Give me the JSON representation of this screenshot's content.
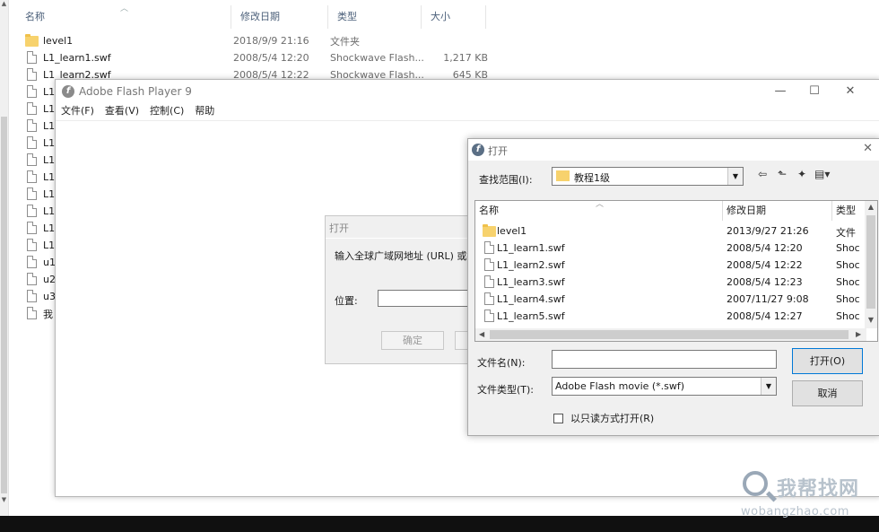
{
  "explorer": {
    "columns": [
      "名称",
      "修改日期",
      "类型",
      "大小"
    ],
    "rows": [
      {
        "name": "level1",
        "date": "2018/9/9 21:16",
        "type": "文件夹",
        "size": "",
        "icon": "folder-icon"
      },
      {
        "name": "L1_learn1.swf",
        "date": "2008/5/4 12:20",
        "type": "Shockwave Flash...",
        "size": "1,217 KB",
        "icon": "file-icon"
      },
      {
        "name": "L1_learn2.swf",
        "date": "2008/5/4 12:22",
        "type": "Shockwave Flash...",
        "size": "645 KB",
        "icon": "file-icon"
      },
      {
        "name": "L1_",
        "icon": "file-icon"
      },
      {
        "name": "L1_",
        "icon": "file-icon"
      },
      {
        "name": "L1_",
        "icon": "file-icon"
      },
      {
        "name": "L1_",
        "icon": "file-icon"
      },
      {
        "name": "L1_",
        "icon": "file-icon"
      },
      {
        "name": "L1_",
        "icon": "file-icon"
      },
      {
        "name": "L1_",
        "icon": "file-icon"
      },
      {
        "name": "L1_",
        "icon": "file-icon"
      },
      {
        "name": "L1_",
        "icon": "file-icon"
      },
      {
        "name": "L1_",
        "icon": "file-icon"
      },
      {
        "name": "u1",
        "icon": "file-icon"
      },
      {
        "name": "u2",
        "icon": "file-icon"
      },
      {
        "name": "u3",
        "icon": "file-icon"
      },
      {
        "name": "我",
        "icon": "shortcut-icon"
      }
    ]
  },
  "flash_window": {
    "title": "Adobe Flash Player 9",
    "menu": [
      "文件(F)",
      "查看(V)",
      "控制(C)",
      "帮助"
    ],
    "controls": {
      "minimize": "—",
      "maximize": "☐",
      "close": "✕"
    }
  },
  "url_dialog": {
    "title": "打开",
    "prompt": "输入全球广域网地址 (URL) 或指",
    "location_label": "位置:",
    "ok_label": "确定"
  },
  "open_dialog": {
    "title": "打开",
    "look_in_label": "查找范围(I):",
    "look_in_value": "教程1级",
    "columns": [
      "名称",
      "修改日期",
      "类型"
    ],
    "files": [
      {
        "name": "level1",
        "date": "2013/9/27 21:26",
        "type": "文件",
        "icon": "folder-icon"
      },
      {
        "name": "L1_learn1.swf",
        "date": "2008/5/4 12:20",
        "type": "Shoc",
        "icon": "file-icon"
      },
      {
        "name": "L1_learn2.swf",
        "date": "2008/5/4 12:22",
        "type": "Shoc",
        "icon": "file-icon"
      },
      {
        "name": "L1_learn3.swf",
        "date": "2008/5/4 12:23",
        "type": "Shoc",
        "icon": "file-icon"
      },
      {
        "name": "L1_learn4.swf",
        "date": "2007/11/27 9:08",
        "type": "Shoc",
        "icon": "file-icon"
      },
      {
        "name": "L1_learn5.swf",
        "date": "2008/5/4 12:27",
        "type": "Shoc",
        "icon": "file-icon"
      }
    ],
    "filename_label": "文件名(N):",
    "filename_value": "",
    "filetype_label": "文件类型(T):",
    "filetype_value": "Adobe Flash movie (*.swf)",
    "open_button": "打开(O)",
    "cancel_button": "取消",
    "readonly_label": "以只读方式打开(R)"
  },
  "watermark": {
    "cn": "我帮找网",
    "en": "wobangzhao.com"
  },
  "colors": {
    "folder": "#f7d26d",
    "accent": "#0078d7"
  }
}
